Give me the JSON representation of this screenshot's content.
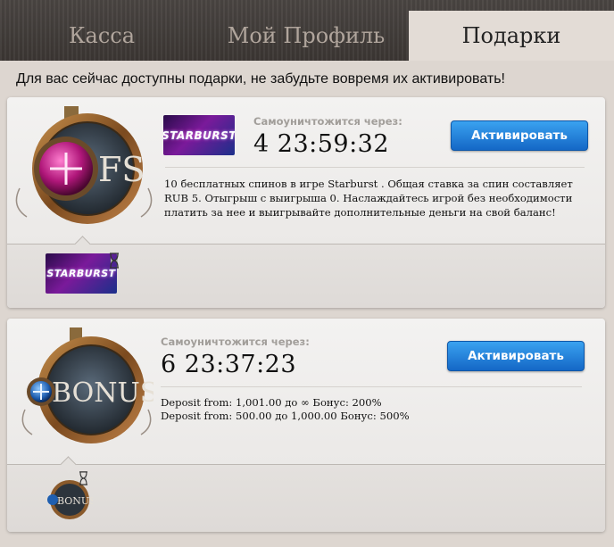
{
  "tabs": [
    {
      "label": "Касса",
      "active": false
    },
    {
      "label": "Мой Профиль",
      "active": false
    },
    {
      "label": "Подарки",
      "active": true
    }
  ],
  "notice": "Для вас сейчас доступны подарки, не забудьте вовремя их активировать!",
  "gifts": [
    {
      "type": "free-spins",
      "medal_text": "FS",
      "game_logo_text": "STARBURST",
      "timer_label": "Самоуничтожится через:",
      "timer_value": "4 23:59:32",
      "button_label": "Активировать",
      "description": "10 бесплатных спинов в игре Starburst . Общая ставка за спин составляет RUB 5. Отыгрыш с выигрыша 0. Наслаждайтесь игрой без необходимости платить за нее и выигрывайте дополнительные деньги на свой баланс!",
      "thumbnail_text": "STARBURST"
    },
    {
      "type": "bonus",
      "medal_text": "BONUS",
      "timer_label": "Самоуничтожится через:",
      "timer_value": "6 23:37:23",
      "button_label": "Активировать",
      "deposit_lines": [
        "Deposit from: 1,001.00 до ∞ Бонус: 200%",
        "Deposit from: 500.00 до 1,000.00 Бонус: 500%"
      ],
      "thumbnail_text": "BONUS"
    }
  ],
  "colors": {
    "accent_blue": "#1f7ad8",
    "header_bg": "#403b38",
    "page_bg": "#ddd6d0",
    "medal_bronze": "#8a5a2b"
  }
}
